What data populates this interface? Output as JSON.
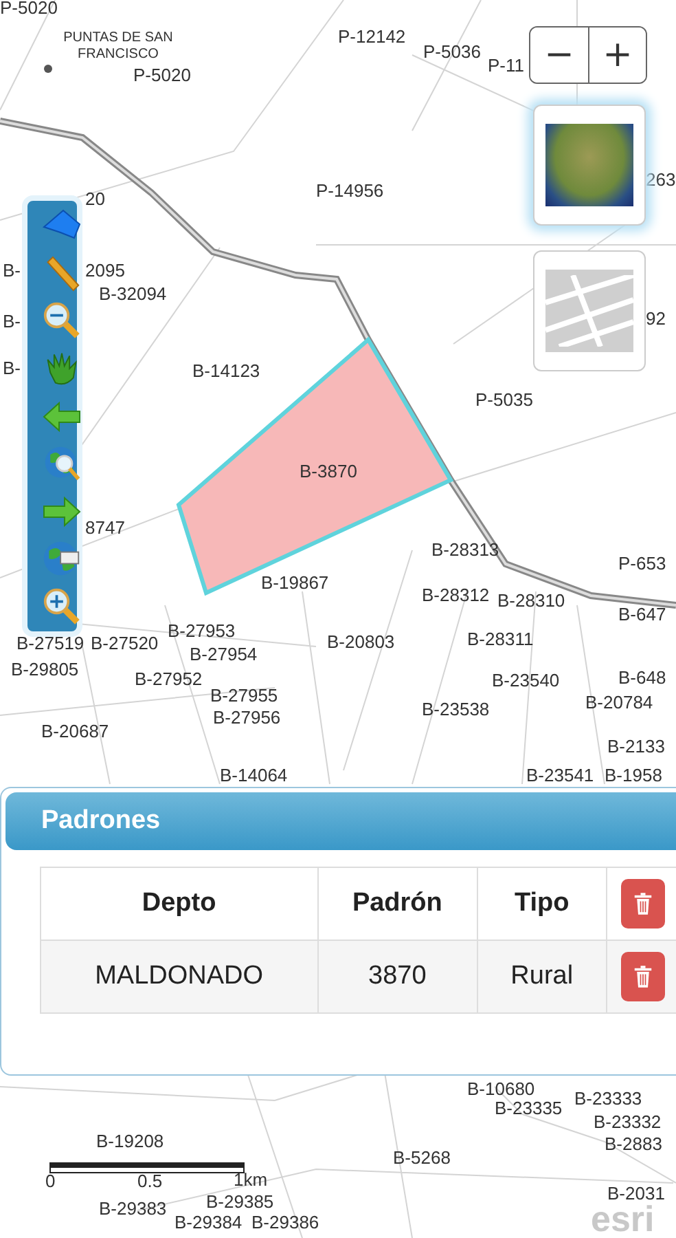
{
  "map": {
    "place_name": "PUNTAS DE SAN FRANCISCO",
    "labels": [
      {
        "text": "P-5020"
      },
      {
        "text": "P-5020"
      },
      {
        "text": "P-12142"
      },
      {
        "text": "P-5036"
      },
      {
        "text": "P-11"
      },
      {
        "text": "P-14956"
      },
      {
        "text": "20"
      },
      {
        "text": "B-"
      },
      {
        "text": "2095"
      },
      {
        "text": "B-32094"
      },
      {
        "text": "B-"
      },
      {
        "text": "B-"
      },
      {
        "text": "B-14123"
      },
      {
        "text": "P-5035"
      },
      {
        "text": "B-3870"
      },
      {
        "text": "8747"
      },
      {
        "text": "B-19867"
      },
      {
        "text": "B-28313"
      },
      {
        "text": "B-28312"
      },
      {
        "text": "B-28310"
      },
      {
        "text": "P-653"
      },
      {
        "text": "B-647"
      },
      {
        "text": "B-27519"
      },
      {
        "text": "B-27520"
      },
      {
        "text": "B-27953"
      },
      {
        "text": "B-27954"
      },
      {
        "text": "B-20803"
      },
      {
        "text": "B-28311"
      },
      {
        "text": "B-29805"
      },
      {
        "text": "B-27952"
      },
      {
        "text": "B-23540"
      },
      {
        "text": "B-648"
      },
      {
        "text": "B-27955"
      },
      {
        "text": "B-27956"
      },
      {
        "text": "B-23538"
      },
      {
        "text": "B-20784"
      },
      {
        "text": "B-20687"
      },
      {
        "text": "B-2133"
      },
      {
        "text": "B-14064"
      },
      {
        "text": "B-23541"
      },
      {
        "text": "B-1958"
      },
      {
        "text": "263"
      },
      {
        "text": "92"
      },
      {
        "text": "B-10680"
      },
      {
        "text": "B-23333"
      },
      {
        "text": "B-23335"
      },
      {
        "text": "B-23332"
      },
      {
        "text": "B-2883"
      },
      {
        "text": "B-19208"
      },
      {
        "text": "B-5268"
      },
      {
        "text": "B-2031"
      },
      {
        "text": "B-29385"
      },
      {
        "text": "B-29383"
      },
      {
        "text": "B-29384"
      },
      {
        "text": "B-29386"
      }
    ],
    "zoom_buttons": [
      "−",
      "+"
    ],
    "basemaps": [
      {
        "kind": "satellite",
        "selected": true
      },
      {
        "kind": "streets",
        "selected": false
      }
    ],
    "scale_bar": {
      "ticks": [
        "0",
        "0.5",
        "1km"
      ]
    },
    "attribution": "esri"
  },
  "panel": {
    "title": "Padrones",
    "columns": [
      "Depto",
      "Padrón",
      "Tipo"
    ],
    "rows": [
      [
        "MALDONADO",
        "3870",
        "Rural"
      ]
    ]
  }
}
